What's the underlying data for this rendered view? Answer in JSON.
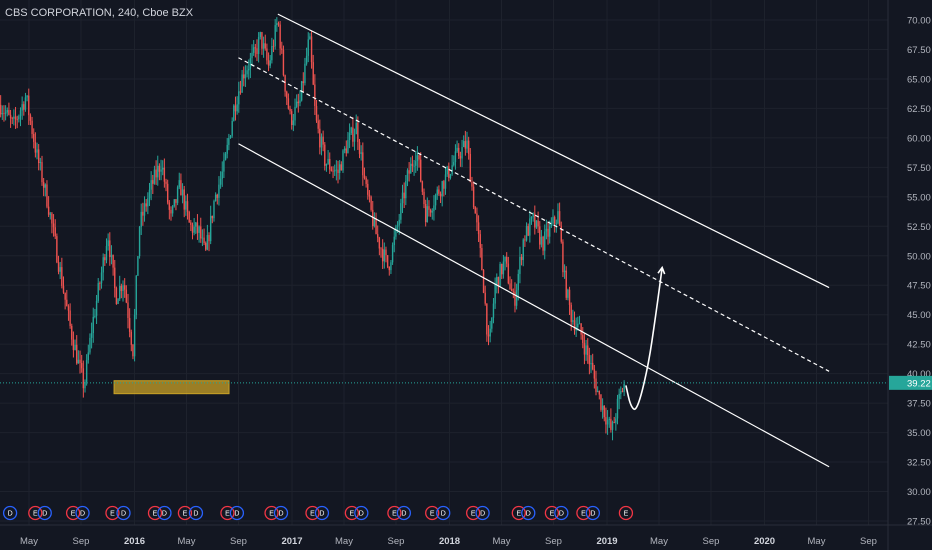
{
  "chart_data": {
    "type": "candlestick",
    "title": "CBS CORPORATION, 240, Cboe BZX",
    "yticks": [
      "70.00",
      "67.50",
      "65.00",
      "62.50",
      "60.00",
      "57.50",
      "55.00",
      "52.50",
      "50.00",
      "47.50",
      "45.00",
      "42.50",
      "40.00",
      "37.50",
      "35.00",
      "32.50",
      "30.00",
      "27.50"
    ],
    "ylim": [
      26.5,
      71.5
    ],
    "xticks": [
      {
        "label": "May",
        "t": 0.0,
        "bold": false
      },
      {
        "label": "Sep",
        "t": 0.33,
        "bold": false
      },
      {
        "label": "2016",
        "t": 0.67,
        "bold": true
      },
      {
        "label": "May",
        "t": 1.0,
        "bold": false
      },
      {
        "label": "Sep",
        "t": 1.33,
        "bold": false
      },
      {
        "label": "2017",
        "t": 1.67,
        "bold": true
      },
      {
        "label": "May",
        "t": 2.0,
        "bold": false
      },
      {
        "label": "Sep",
        "t": 2.33,
        "bold": false
      },
      {
        "label": "2018",
        "t": 2.67,
        "bold": true
      },
      {
        "label": "May",
        "t": 3.0,
        "bold": false
      },
      {
        "label": "Sep",
        "t": 3.33,
        "bold": false
      },
      {
        "label": "2019",
        "t": 3.67,
        "bold": true
      },
      {
        "label": "May",
        "t": 4.0,
        "bold": false
      },
      {
        "label": "Sep",
        "t": 4.33,
        "bold": false
      },
      {
        "label": "2020",
        "t": 4.67,
        "bold": true
      },
      {
        "label": "May",
        "t": 5.0,
        "bold": false
      },
      {
        "label": "Sep",
        "t": 5.33,
        "bold": false
      }
    ],
    "price_path": [
      [
        -0.18,
        62.8
      ],
      [
        -0.1,
        61.0
      ],
      [
        -0.02,
        63.5
      ],
      [
        0.05,
        58.5
      ],
      [
        0.12,
        54.5
      ],
      [
        0.2,
        48.5
      ],
      [
        0.26,
        44.0
      ],
      [
        0.32,
        40.5
      ],
      [
        0.35,
        38.9
      ],
      [
        0.4,
        44.0
      ],
      [
        0.46,
        48.5
      ],
      [
        0.5,
        52.0
      ],
      [
        0.55,
        46.5
      ],
      [
        0.6,
        48.0
      ],
      [
        0.66,
        42.0
      ],
      [
        0.7,
        52.5
      ],
      [
        0.78,
        56.0
      ],
      [
        0.84,
        58.0
      ],
      [
        0.9,
        53.0
      ],
      [
        0.96,
        56.0
      ],
      [
        1.02,
        52.5
      ],
      [
        1.08,
        52.0
      ],
      [
        1.12,
        50.0
      ],
      [
        1.18,
        55.0
      ],
      [
        1.24,
        57.5
      ],
      [
        1.3,
        62.5
      ],
      [
        1.36,
        65.5
      ],
      [
        1.43,
        67.0
      ],
      [
        1.47,
        68.5
      ],
      [
        1.52,
        66.0
      ],
      [
        1.58,
        70.0
      ],
      [
        1.62,
        65.0
      ],
      [
        1.66,
        61.5
      ],
      [
        1.72,
        63.0
      ],
      [
        1.78,
        68.5
      ],
      [
        1.82,
        61.5
      ],
      [
        1.88,
        58.0
      ],
      [
        1.96,
        57.0
      ],
      [
        2.02,
        59.5
      ],
      [
        2.08,
        61.0
      ],
      [
        2.14,
        55.5
      ],
      [
        2.2,
        52.0
      ],
      [
        2.28,
        49.0
      ],
      [
        2.34,
        52.5
      ],
      [
        2.4,
        56.5
      ],
      [
        2.46,
        59.0
      ],
      [
        2.52,
        53.5
      ],
      [
        2.6,
        55.5
      ],
      [
        2.66,
        57.0
      ],
      [
        2.72,
        58.5
      ],
      [
        2.78,
        59.5
      ],
      [
        2.82,
        55.0
      ],
      [
        2.88,
        48.5
      ],
      [
        2.92,
        42.0
      ],
      [
        2.96,
        47.5
      ],
      [
        3.02,
        49.5
      ],
      [
        3.08,
        46.0
      ],
      [
        3.14,
        51.5
      ],
      [
        3.2,
        53.0
      ],
      [
        3.26,
        51.0
      ],
      [
        3.3,
        52.0
      ],
      [
        3.36,
        53.5
      ],
      [
        3.4,
        48.0
      ],
      [
        3.44,
        45.0
      ],
      [
        3.5,
        43.5
      ],
      [
        3.56,
        41.0
      ],
      [
        3.62,
        38.0
      ],
      [
        3.66,
        36.5
      ],
      [
        3.7,
        35.0
      ],
      [
        3.74,
        37.5
      ],
      [
        3.78,
        39.2
      ]
    ],
    "channel_upper": {
      "from": [
        1.58,
        70.5
      ],
      "to": [
        5.08,
        47.3
      ]
    },
    "channel_lower": {
      "from": [
        1.33,
        59.5
      ],
      "to": [
        5.08,
        32.1
      ]
    },
    "channel_mid": {
      "from": [
        1.33,
        66.8
      ],
      "to": [
        5.08,
        40.2
      ]
    },
    "support_zone": {
      "x0": 0.54,
      "x1": 1.27,
      "y0": 38.3,
      "y1": 39.4,
      "color": "#c9a227"
    },
    "projection": [
      [
        3.79,
        39.0
      ],
      [
        3.82,
        37.2
      ],
      [
        3.86,
        36.8
      ],
      [
        3.93,
        40.5
      ],
      [
        3.98,
        45.0
      ],
      [
        4.02,
        49.0
      ]
    ],
    "last_price": "39.22",
    "last_price_value": 39.22,
    "earnings_markers": [
      {
        "label": "D",
        "t": -0.12,
        "color": "#2962ff"
      },
      {
        "label": "E",
        "t": 0.04,
        "color": "#f23645"
      },
      {
        "label": "D",
        "t": 0.1,
        "color": "#2962ff"
      },
      {
        "label": "E",
        "t": 0.28,
        "color": "#f23645"
      },
      {
        "label": "D",
        "t": 0.34,
        "color": "#2962ff"
      },
      {
        "label": "E",
        "t": 0.53,
        "color": "#f23645"
      },
      {
        "label": "D",
        "t": 0.6,
        "color": "#2962ff"
      },
      {
        "label": "E",
        "t": 0.8,
        "color": "#f23645"
      },
      {
        "label": "D",
        "t": 0.86,
        "color": "#2962ff"
      },
      {
        "label": "E",
        "t": 0.99,
        "color": "#f23645"
      },
      {
        "label": "D",
        "t": 1.06,
        "color": "#2962ff"
      },
      {
        "label": "E",
        "t": 1.26,
        "color": "#f23645"
      },
      {
        "label": "D",
        "t": 1.32,
        "color": "#2962ff"
      },
      {
        "label": "E",
        "t": 1.54,
        "color": "#f23645"
      },
      {
        "label": "D",
        "t": 1.6,
        "color": "#2962ff"
      },
      {
        "label": "E",
        "t": 1.8,
        "color": "#f23645"
      },
      {
        "label": "D",
        "t": 1.86,
        "color": "#2962ff"
      },
      {
        "label": "E",
        "t": 2.05,
        "color": "#f23645"
      },
      {
        "label": "D",
        "t": 2.11,
        "color": "#2962ff"
      },
      {
        "label": "E",
        "t": 2.32,
        "color": "#f23645"
      },
      {
        "label": "D",
        "t": 2.38,
        "color": "#2962ff"
      },
      {
        "label": "E",
        "t": 2.56,
        "color": "#f23645"
      },
      {
        "label": "D",
        "t": 2.63,
        "color": "#2962ff"
      },
      {
        "label": "E",
        "t": 2.82,
        "color": "#f23645"
      },
      {
        "label": "D",
        "t": 2.88,
        "color": "#2962ff"
      },
      {
        "label": "E",
        "t": 3.11,
        "color": "#f23645"
      },
      {
        "label": "D",
        "t": 3.17,
        "color": "#2962ff"
      },
      {
        "label": "E",
        "t": 3.32,
        "color": "#f23645"
      },
      {
        "label": "D",
        "t": 3.38,
        "color": "#2962ff"
      },
      {
        "label": "E",
        "t": 3.52,
        "color": "#f23645"
      },
      {
        "label": "D",
        "t": 3.58,
        "color": "#2962ff"
      },
      {
        "label": "E",
        "t": 3.79,
        "color": "#f23645"
      }
    ]
  },
  "colors": {
    "background": "#131722",
    "grid": "#1e222d",
    "up": "#26a69a",
    "down": "#ef5350",
    "line": "#ffffff",
    "price_line": "#26a69a",
    "price_label_bg": "#26a69a",
    "axis_text": "#b2b5be"
  }
}
